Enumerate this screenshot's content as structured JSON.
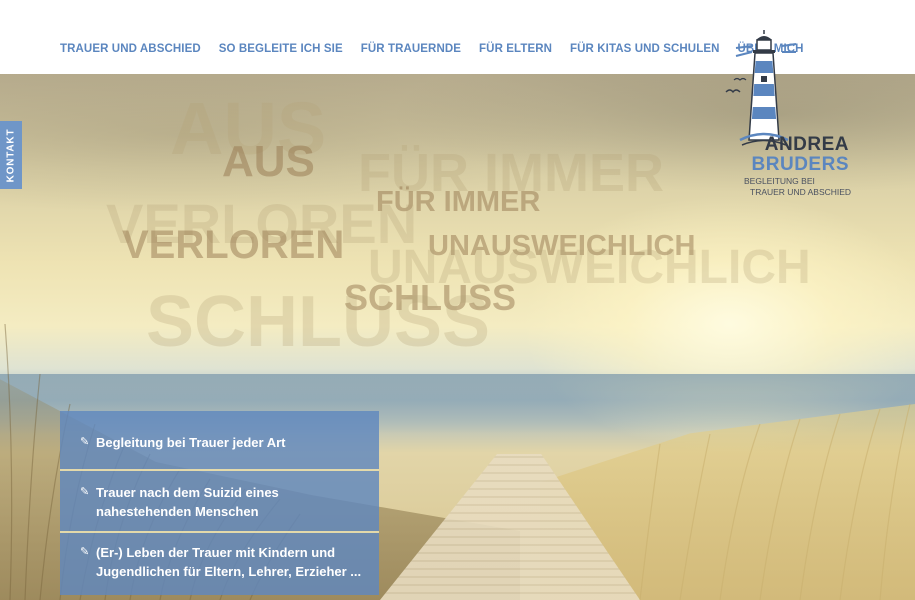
{
  "nav": {
    "items": [
      {
        "label": "TRAUER UND ABSCHIED"
      },
      {
        "label": "SO BEGLEITE ICH SIE"
      },
      {
        "label": "FÜR TRAUERNDE"
      },
      {
        "label": "FÜR ELTERN"
      },
      {
        "label": "FÜR KITAS UND SCHULEN"
      },
      {
        "label": "ÜBER MICH"
      }
    ]
  },
  "contact_tab": {
    "label": "KONTAKT"
  },
  "logo": {
    "first_name": "ANDREA",
    "last_name": "BRUDERS",
    "tagline_1": "BEGLEITUNG BEI",
    "tagline_2": "TRAUER UND ABSCHIED",
    "icon": "lighthouse-icon"
  },
  "hero_words": {
    "aus_large": "AUS",
    "aus_small": "AUS",
    "fuer_immer_large": "FÜR IMMER",
    "fuer_immer_small": "FÜR IMMER",
    "verloren_large": "VERLOREN",
    "verloren_small": "VERLOREN",
    "unausweichlich_small": "UNAUSWEICHLICH",
    "unausweichlich_large": "UNAUSWEICHLICH",
    "schluss_small": "SCHLUSS",
    "schluss_large": "SCHLUSS"
  },
  "features": [
    {
      "text": "Begleitung bei Trauer jeder Art",
      "icon": "pencil-icon"
    },
    {
      "text": "Trauer nach dem Suizid eines nahestehenden Menschen",
      "icon": "pencil-icon"
    },
    {
      "text": "(Er-) Leben der Trauer mit Kindern und Jugendlichen für Eltern, Lehrer, Erzieher ...",
      "icon": "pencil-icon"
    }
  ],
  "colors": {
    "accent_blue": "#5b86bf",
    "feature_box": "#5f87be",
    "dark_text": "#333b47"
  }
}
